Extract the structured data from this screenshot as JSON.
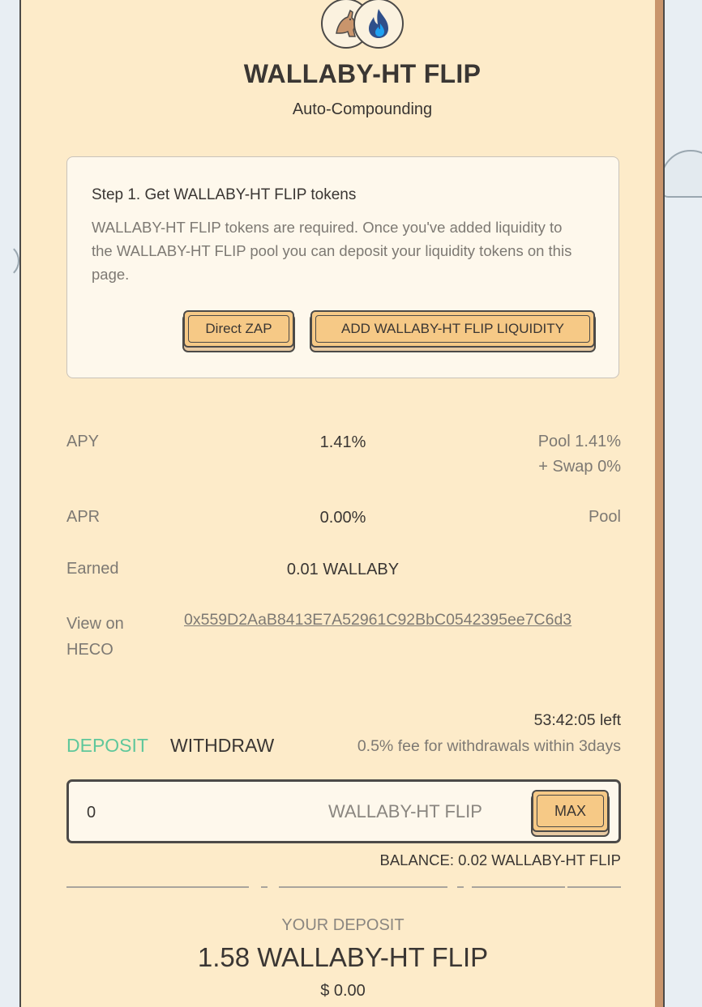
{
  "header": {
    "title": "WALLABY-HT FLIP",
    "subtitle": "Auto-Compounding"
  },
  "step": {
    "title": "Step 1. Get WALLABY-HT FLIP tokens",
    "description": "WALLABY-HT FLIP tokens are required. Once you've added liquidity to the WALLABY-HT FLIP pool you can deposit your liquidity tokens on this page.",
    "zap_label": "Direct ZAP",
    "add_liquidity_label": "ADD WALLABY-HT FLIP LIQUIDITY"
  },
  "stats": {
    "apy_label": "APY",
    "apy_value": "1.41%",
    "apy_pool": "Pool 1.41%",
    "apy_swap": "+ Swap 0%",
    "apr_label": "APR",
    "apr_value": "0.00%",
    "apr_source": "Pool",
    "earned_label": "Earned",
    "earned_value": "0.01 WALLABY",
    "view_label_line1": "View on",
    "view_label_line2": "HECO",
    "contract_address": "0x559D2AaB8413E7A52961C92BbC0542395ee7C6d3"
  },
  "action": {
    "timer": "53:42:05 left",
    "deposit_tab": "DEPOSIT",
    "withdraw_tab": "WITHDRAW",
    "fee_note": "0.5% fee for withdrawals within 3days",
    "input_value": "0",
    "input_unit": "WALLABY-HT FLIP",
    "max_label": "MAX",
    "balance": "BALANCE: 0.02 WALLABY-HT FLIP"
  },
  "deposit": {
    "label": "YOUR DEPOSIT",
    "amount": "1.58 WALLABY-HT FLIP",
    "usd": "$ 0.00"
  },
  "colors": {
    "panel_bg": "#fdebc9",
    "button_bg": "#f6c986",
    "deposit_tab": "#5fc79b",
    "ht_blue": "#2f6fd6"
  }
}
